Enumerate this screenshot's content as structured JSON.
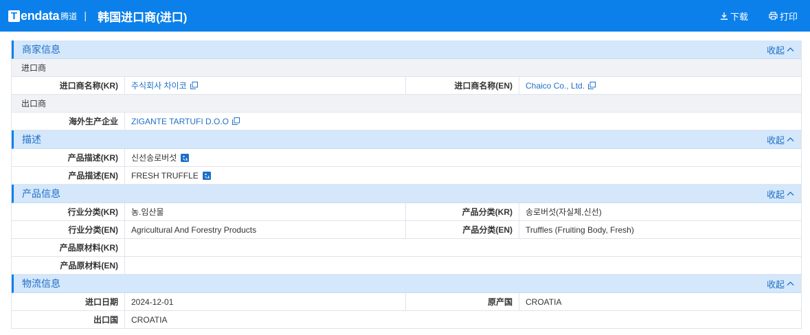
{
  "header": {
    "logo_word": "endata",
    "logo_cn": "腾道",
    "separator": "|",
    "title": "韩国进口商(进口)",
    "download_label": "下载",
    "print_label": "打印"
  },
  "sections": {
    "merchant": {
      "title": "商家信息",
      "collapse_label": "收起",
      "importer_subhead": "进口商",
      "importer_kr_label": "进口商名称(KR)",
      "importer_kr_value": "주식회사 차이코",
      "importer_en_label": "进口商名称(EN)",
      "importer_en_value": "Chaico Co., Ltd.",
      "exporter_subhead": "出口商",
      "overseas_label": "海外生产企业",
      "overseas_value": "ZIGANTE TARTUFI D.O.O"
    },
    "description": {
      "title": "描述",
      "collapse_label": "收起",
      "desc_kr_label": "产品描述(KR)",
      "desc_kr_value": "신선송로버섯",
      "desc_en_label": "产品描述(EN)",
      "desc_en_value": "FRESH TRUFFLE"
    },
    "product": {
      "title": "产品信息",
      "collapse_label": "收起",
      "industry_kr_label": "行业分类(KR)",
      "industry_kr_value": "농.임산물",
      "category_kr_label": "产品分类(KR)",
      "category_kr_value": "송로버섯(자실체,신선)",
      "industry_en_label": "行业分类(EN)",
      "industry_en_value": "Agricultural And Forestry Products",
      "category_en_label": "产品分类(EN)",
      "category_en_value": "Truffles (Fruiting Body, Fresh)",
      "material_kr_label": "产品原材料(KR)",
      "material_kr_value": "",
      "material_en_label": "产品原材料(EN)",
      "material_en_value": ""
    },
    "logistics": {
      "title": "物流信息",
      "collapse_label": "收起",
      "import_date_label": "进口日期",
      "import_date_value": "2024-12-01",
      "origin_label": "原产国",
      "origin_value": "CROATIA",
      "export_country_label": "出口国",
      "export_country_value": "CROATIA"
    }
  },
  "colors": {
    "brand_blue": "#0b80ea",
    "section_bg": "#d4e7fb",
    "link": "#1f6fc7"
  }
}
